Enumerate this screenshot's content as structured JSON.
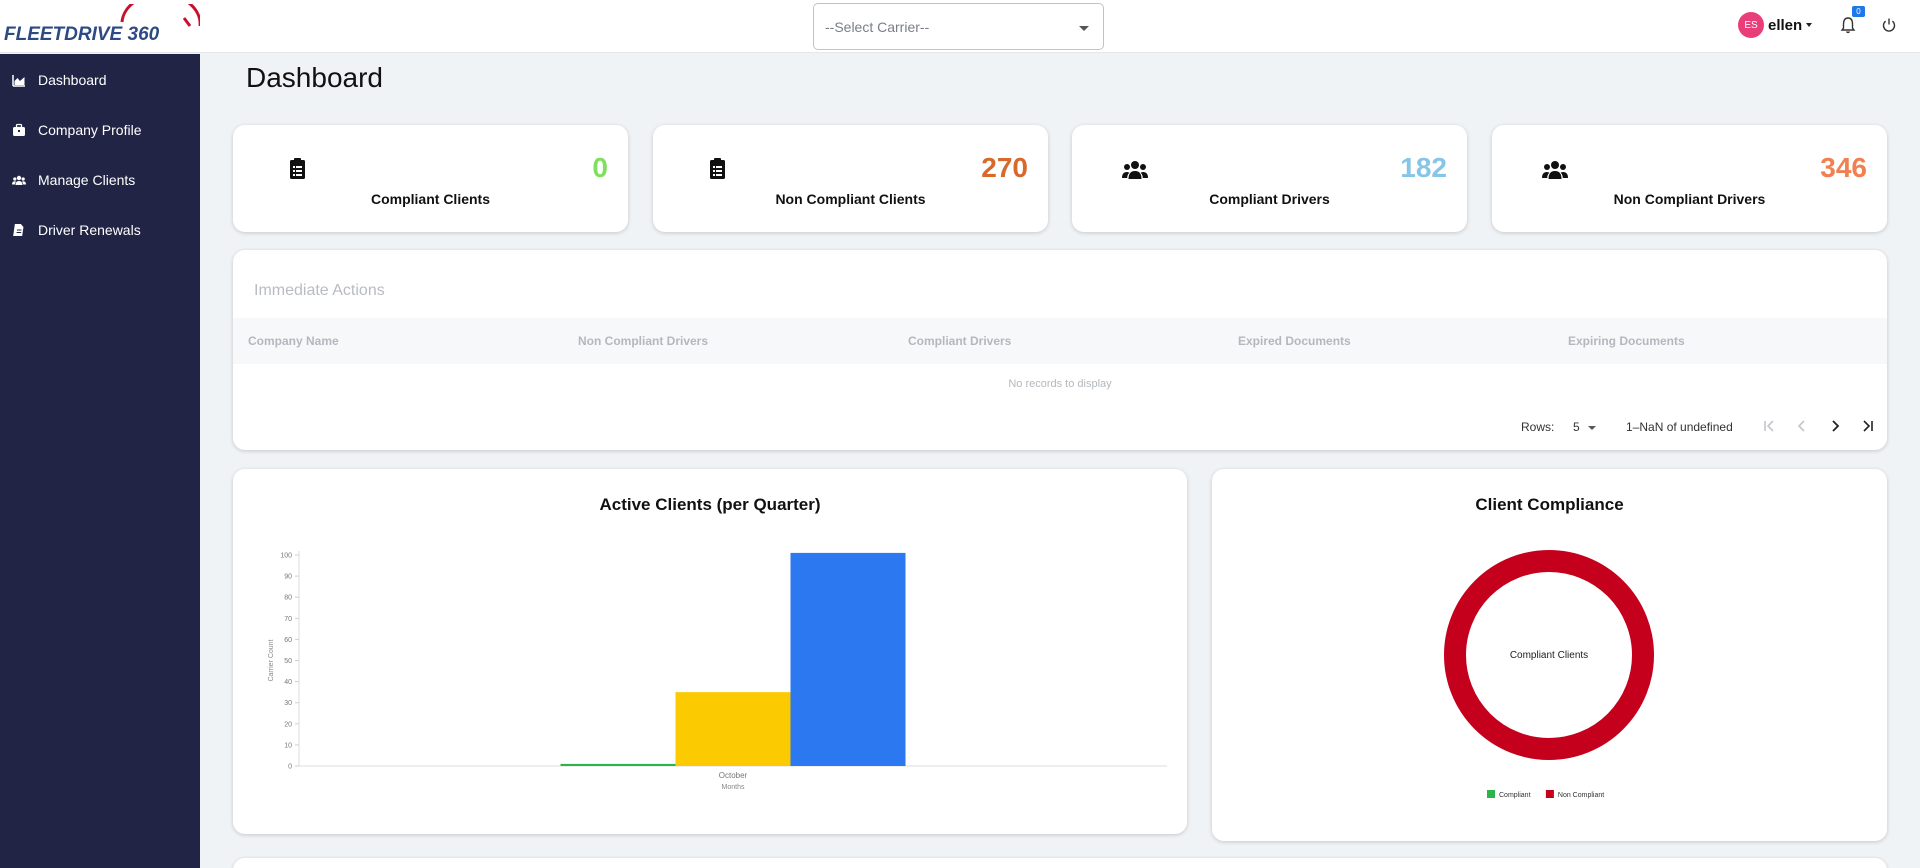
{
  "app": {
    "logo_text": "FLEETDRIVE 360"
  },
  "header": {
    "carrier_select": {
      "value": "--Select Carrier--"
    },
    "user": {
      "initials": "ES",
      "name": "ellen"
    },
    "notifications": {
      "count": "0"
    },
    "icons": {
      "bell": "bell-icon",
      "power": "power-icon"
    }
  },
  "sidebar": {
    "items": [
      {
        "label": "Dashboard",
        "icon": "chart-area-icon"
      },
      {
        "label": "Company Profile",
        "icon": "briefcase-icon"
      },
      {
        "label": "Manage Clients",
        "icon": "users-icon"
      },
      {
        "label": "Driver Renewals",
        "icon": "file-icon"
      }
    ]
  },
  "page": {
    "title": "Dashboard"
  },
  "stats": [
    {
      "value": "0",
      "label": "Compliant Clients",
      "color": "#7ee05f",
      "icon": "clipboard-icon"
    },
    {
      "value": "270",
      "label": "Non Compliant Clients",
      "color": "#d8692a",
      "icon": "clipboard-icon"
    },
    {
      "value": "182",
      "label": "Compliant Drivers",
      "color": "#86c5e6",
      "icon": "users-icon"
    },
    {
      "value": "346",
      "label": "Non Compliant Drivers",
      "color": "#f08050",
      "icon": "users-icon"
    }
  ],
  "immediate_actions": {
    "title": "Immediate Actions",
    "columns": [
      "Company Name",
      "Non Compliant Drivers",
      "Compliant Drivers",
      "Expired Documents",
      "Expiring Documents"
    ],
    "empty_text": "No records to display",
    "pagination": {
      "rows_label": "Rows:",
      "rows_value": "5",
      "range_text": "1–NaN of undefined"
    }
  },
  "chart_data": [
    {
      "type": "bar",
      "title": "Active Clients (per Quarter)",
      "xlabel": "Months",
      "ylabel": "Carrier Count",
      "categories": [
        "October"
      ],
      "series": [
        {
          "color": "#2cb34a",
          "values": [
            1
          ]
        },
        {
          "color": "#fcca00",
          "values": [
            35
          ]
        },
        {
          "color": "#2b78f0",
          "values": [
            101
          ]
        }
      ],
      "ylim": [
        0,
        100
      ],
      "yticks": [
        0,
        10,
        20,
        30,
        40,
        50,
        60,
        70,
        80,
        90,
        100
      ]
    },
    {
      "type": "pie",
      "title": "Client Compliance",
      "center_label": "Compliant Clients",
      "categories": [
        "Compliant",
        "Non Compliant"
      ],
      "values": [
        0,
        270
      ],
      "colors": [
        "#2cb34a",
        "#c4001d"
      ],
      "legend": "bottom"
    }
  ]
}
